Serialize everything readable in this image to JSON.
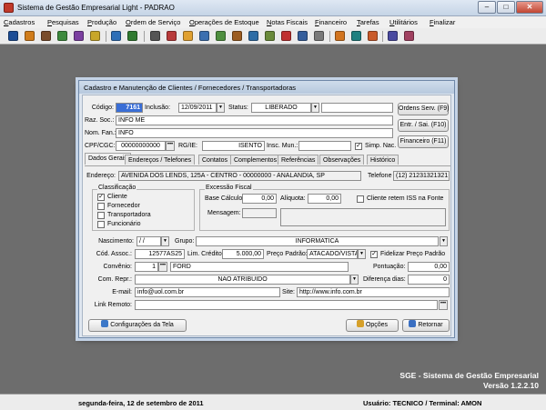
{
  "window": {
    "title": "Sistema de Gestão Empresarial Light - PADRAO",
    "minimize": "‒",
    "maximize": "□",
    "close": "✕"
  },
  "menu": [
    "Cadastros",
    "Pesquisas",
    "Produção",
    "Ordem de Serviço",
    "Operações de Estoque",
    "Notas Fiscais",
    "Financeiro",
    "Tarefas",
    "Utilitários",
    "Finalizar"
  ],
  "toolbar_colors": [
    "#1c4d96",
    "#d07c1a",
    "#7a4c2a",
    "#3d8a3d",
    "#7b3fa0",
    "#c8a628",
    "#2d6fb7",
    "#2f7a2f",
    "#555555",
    "#b83a3a",
    "#e0a030",
    "#3b6fb0",
    "#4f8f3f",
    "#9c5c20",
    "#2e6da6",
    "#6a8a3a",
    "#c03030",
    "#355e9c",
    "#7a7a7a",
    "#d2741e",
    "#1e8080",
    "#c95a2a",
    "#4a4aa0",
    "#a04060",
    "#2d6fb7",
    "#3b3b8f"
  ],
  "dialog": {
    "title": "Cadastro e Manutenção de Clientes / Fornecedores / Transportadoras",
    "codigo_label": "Código:",
    "codigo": "7161",
    "inclusao_label": "Inclusão:",
    "inclusao": "12/09/2011",
    "status_label": "Status:",
    "status": "LIBERADO",
    "raz_soc_label": "Raz. Soc.:",
    "raz_soc": "INFO ME",
    "nom_fan_label": "Nom. Fan.:",
    "nom_fan": "INFO",
    "cpf_label": "CPF/CGC:",
    "cpf": "00000000000",
    "rg_label": "RG/IE:",
    "rg": "ISENTO",
    "insc_mun_label": "Insc. Mun.:",
    "insc_mun": "",
    "simp_nac_label": "Simp. Nac.",
    "simp_nac_checked": "✓",
    "btn_ordens": "Ordens Serv. (F9)",
    "btn_entr": "Entr. / Sai. (F10)",
    "btn_financeiro": "Financeiro (F11)",
    "tabs": [
      "Dados Gerais",
      "Endereços / Telefones",
      "Contatos",
      "Complementos",
      "Referências",
      "Observações",
      "Histórico"
    ],
    "endereco_label": "Endereço:",
    "endereco": "AVENIDA DOS LENDS, 125A - CENTRO - 00000000 - ANALANDIA, SP",
    "telefone_label": "Telefone",
    "telefone": "(12) 21231321321",
    "classificacao_label": "Classificação",
    "class_items": [
      {
        "label": "Cliente",
        "mark": "✓"
      },
      {
        "label": "Fornecedor",
        "mark": ""
      },
      {
        "label": "Transportadora",
        "mark": ""
      },
      {
        "label": "Funcionário",
        "mark": ""
      }
    ],
    "excecao_label": "Excessão Fiscal",
    "base_calculo_label": "Base Cálculo:",
    "base_calculo": "0,00",
    "aliquota_label": "Alíquota:",
    "aliquota": "0,00",
    "mensagem_label": "Mensagem:",
    "iss_label": "Cliente retem ISS na Fonte",
    "nascimento_label": "Nascimento:",
    "nascimento": "/ /",
    "grupo_label": "Grupo:",
    "grupo": "INFORMATICA",
    "cod_assoc_label": "Cód. Assoc.:",
    "cod_assoc": "12577AS25",
    "lim_credito_label": "Lim. Crédito:",
    "lim_credito": "5.000,00",
    "preco_padrao_label": "Preço Padrão:",
    "preco_padrao": "ATACADO/VISTA",
    "fidelizar_label": "Fidelizar Preço Padrão",
    "fidelizar_checked": "✓",
    "convenio_label": "Convênio:",
    "convenio_code": "1",
    "convenio": "FORD",
    "pontuacao_label": "Pontuação:",
    "pontuacao": "0,00",
    "com_repr_label": "Com. Repr.:",
    "com_repr": "NAO ATRIBUIDO",
    "diferenca_label": "Diferença dias:",
    "diferenca": "0",
    "email_label": "E-mail:",
    "email": "info@uol.com.br",
    "site_label": "Site:",
    "site": "http://www.info.com.br",
    "link_label": "Link Remoto:",
    "link": "",
    "btn_config": "Configurações da Tela",
    "btn_opcoes": "Opções",
    "btn_retornar": "Retornar"
  },
  "brand": {
    "line1": "SGE - Sistema de Gestão Empresarial",
    "line2": "Versão 1.2.2.10"
  },
  "status": {
    "date": "segunda-feira, 12 de setembro de 2011",
    "user": "Usuário: TECNICO / Terminal: AMON"
  }
}
